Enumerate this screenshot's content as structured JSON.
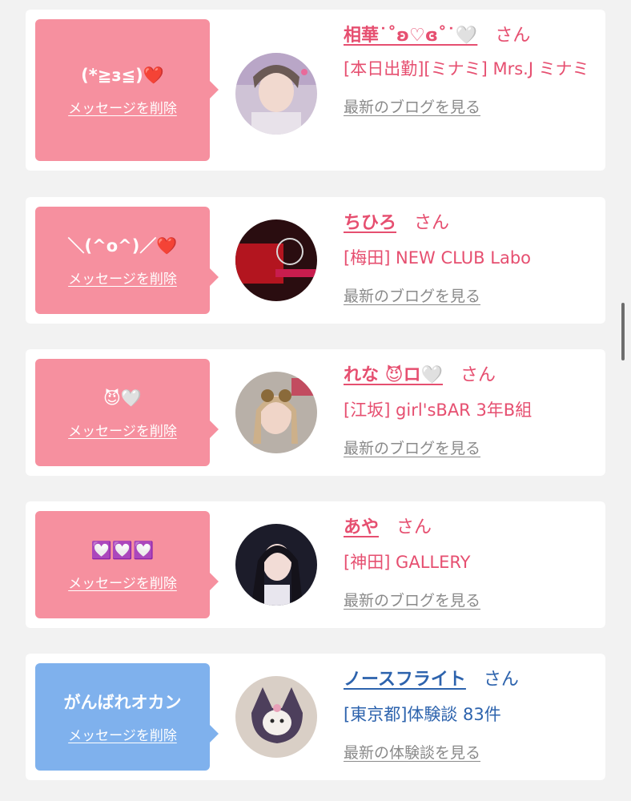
{
  "cards": [
    {
      "message": "(*≧з≦)❤️",
      "delete_label": "メッセージを削除",
      "name": "相華˙˚ʚ♡ɞ˚˙🤍",
      "san": "さん",
      "shop": "[本日出勤][ミナミ] Mrs.J ミナミ",
      "blog_link": "最新のブログを見る",
      "bubble_color": "#f6909f",
      "avatar_icon": "person-photo"
    },
    {
      "message": "＼(^o^)／❤️",
      "delete_label": "メッセージを削除",
      "name": "ちひろ",
      "san": "さん",
      "shop": "[梅田] NEW CLUB Labo",
      "blog_link": "最新のブログを見る",
      "bubble_color": "#f6909f",
      "avatar_icon": "club-logo-photo"
    },
    {
      "message": "😈🤍",
      "delete_label": "メッセージを削除",
      "name": "れな 😈ロ🤍",
      "san": "さん",
      "shop": "[江坂] girl'sBAR 3年B組",
      "blog_link": "最新のブログを見る",
      "bubble_color": "#f6909f",
      "avatar_icon": "person-photo"
    },
    {
      "message": "💟💟💟",
      "delete_label": "メッセージを削除",
      "name": "あや",
      "san": "さん",
      "shop": "[神田] GALLERY",
      "blog_link": "最新のブログを見る",
      "bubble_color": "#f6909f",
      "avatar_icon": "person-photo"
    },
    {
      "message": "がんばれオカン",
      "delete_label": "メッセージを削除",
      "name": "ノースフライト",
      "san": "さん",
      "shop": "[東京都]体験談 83件",
      "blog_link": "最新の体験談を見る",
      "bubble_color": "#7fb1ed",
      "avatar_icon": "character-plush-photo"
    }
  ]
}
